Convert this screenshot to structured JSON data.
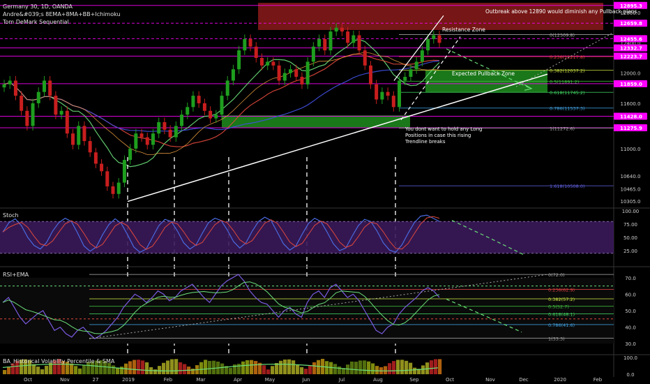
{
  "header": {
    "title": "Germany 30, 1D, OANDA",
    "indicator1": "Andre&#039;s 8EMA+8MA+BB+Ichimoku",
    "indicator2": "Tom DeMark Sequential"
  },
  "annotations": {
    "outbreak": "Outbreak above 12890 would diminish any Pullback plans",
    "resistance_zone": "Resistance Zone",
    "pullback_zone": "Expected Pullback Zone",
    "trendline_note_1": "You dont want to hold any Long",
    "trendline_note_2": "Positions in case this rising",
    "trendline_note_3": "Trendline breaks"
  },
  "panes": {
    "stoch": "Stoch",
    "rsi": "RSI+EMA",
    "hv": "BA_Historical Volatility Percentile & SMA"
  },
  "colors": {
    "background": "#000000",
    "magenta": "#ff00ff",
    "resistance_fill": "#8b1a1a",
    "support_fill": "#1e8c1e",
    "candle_up": "#1e9e1e",
    "candle_down": "#c81e1e",
    "stoch_bg": "#3a1a5a",
    "ema_green": "#6be07a",
    "ma_red": "#e0483c",
    "ma_blue": "#4050e0",
    "trendline": "#ffffff"
  },
  "chart_data": {
    "type": "candlestick",
    "instrument": "Germany 30",
    "timeframe": "1D",
    "x_tick_labels": [
      "Oct",
      "Nov",
      "27",
      "2019",
      "Feb",
      "Mar",
      "Apr",
      "May",
      "Jun",
      "Jul",
      "Aug",
      "Sep",
      "Oct",
      "Nov",
      "Dec",
      "2020",
      "Feb"
    ],
    "y_tick_labels": [
      "12800.0",
      "12400.0",
      "12000.0",
      "11600.0",
      "11000.0",
      "10640.0",
      "10465.0",
      "10305.0"
    ],
    "ylim": [
      10250,
      12930
    ],
    "price_tags": [
      {
        "label": "12895.3",
        "value": 12895.3
      },
      {
        "label": "12659.8",
        "value": 12659.8
      },
      {
        "label": "12455.6",
        "value": 12455.6
      },
      {
        "label": "12332.7",
        "value": 12332.7
      },
      {
        "label": "12223.7",
        "value": 12223.7
      },
      {
        "label": "11859.0",
        "value": 11859.0
      },
      {
        "label": "11428.0",
        "value": 11428.0
      },
      {
        "label": "11275.9",
        "value": 11275.9
      }
    ],
    "fib_levels": [
      {
        "label": "0(12509.8)",
        "value": 12509.8,
        "color": "#aaaaaa"
      },
      {
        "label": "0.236(12217.8)",
        "value": 12217.8,
        "color": "#e04040"
      },
      {
        "label": "0.382(12037.2)",
        "value": 12037.2,
        "color": "#c8e040"
      },
      {
        "label": "0.5(11891.2)",
        "value": 11891.2,
        "color": "#40c040"
      },
      {
        "label": "0.618(11745.2)",
        "value": 11745.2,
        "color": "#40d060"
      },
      {
        "label": "0.786(11537.3)",
        "value": 11537.3,
        "color": "#40a0e0"
      },
      {
        "label": "1(11272.6)",
        "value": 11272.6,
        "color": "#aaaaaa"
      },
      {
        "label": "1.618(10508.0)",
        "value": 10508.0,
        "color": "#6060e0"
      }
    ],
    "zones": [
      {
        "name": "resistance",
        "from": 12570,
        "to": 12930
      },
      {
        "name": "support",
        "from": 11280,
        "to": 11440
      },
      {
        "name": "pullback",
        "from": 11745,
        "to": 12037
      }
    ],
    "close_series": [
      11850,
      11900,
      11700,
      11500,
      11300,
      11600,
      11750,
      11900,
      11700,
      11450,
      11500,
      11200,
      11050,
      11300,
      11100,
      10950,
      10800,
      10700,
      10500,
      10400,
      10550,
      10850,
      11000,
      11200,
      11150,
      11050,
      11200,
      11350,
      11250,
      11150,
      11300,
      11450,
      11550,
      11700,
      11600,
      11500,
      11400,
      11450,
      11700,
      11900,
      12050,
      12300,
      12450,
      12350,
      12200,
      12100,
      12150,
      12100,
      11900,
      12000,
      12050,
      11950,
      11850,
      12150,
      12350,
      12450,
      12300,
      12550,
      12600,
      12550,
      12400,
      12500,
      12300,
      12100,
      11850,
      11650,
      11750,
      11700,
      11550,
      11900,
      11950,
      12050,
      12150,
      12300,
      12450,
      12500,
      12400
    ],
    "stoch": {
      "yticks": [
        "100.00",
        "75.00",
        "50.00",
        "25.00"
      ],
      "ylim": [
        0,
        100
      ],
      "k": [
        60,
        78,
        85,
        72,
        50,
        35,
        28,
        40,
        62,
        78,
        86,
        80,
        58,
        34,
        24,
        32,
        55,
        74,
        85,
        76,
        55,
        32,
        22,
        28,
        50,
        72,
        84,
        80,
        62,
        40,
        28,
        36,
        58,
        78,
        86,
        82,
        64,
        42,
        30,
        40,
        62,
        80,
        88,
        82,
        60,
        38,
        26,
        34,
        56,
        76,
        86,
        80,
        60,
        38,
        25,
        30,
        52,
        72,
        84,
        80,
        62,
        40,
        26,
        22,
        36,
        58,
        78,
        90,
        92,
        86,
        80
      ]
    },
    "rsi": {
      "yticks": [
        "70.0",
        "60.0",
        "50.0",
        "40.0",
        "30.0"
      ],
      "ylim": [
        25,
        75
      ],
      "levels": [
        {
          "label": "0(72.0)",
          "value": 72.0,
          "color": "#aaaaaa"
        },
        {
          "label": "0.236(62.9)",
          "value": 62.9,
          "color": "#e04040"
        },
        {
          "label": "0.382(57.2)",
          "value": 57.2,
          "color": "#c8e040"
        },
        {
          "label": "0.5(52.7)",
          "value": 52.7,
          "color": "#40c040"
        },
        {
          "label": "0.618(48.1)",
          "value": 48.1,
          "color": "#40d060"
        },
        {
          "label": "0.786(41.6)",
          "value": 41.6,
          "color": "#40a0e0"
        },
        {
          "label": "1(33.3)",
          "value": 33.3,
          "color": "#aaaaaa"
        }
      ],
      "values": [
        55,
        58,
        52,
        46,
        42,
        45,
        48,
        50,
        44,
        38,
        40,
        36,
        34,
        38,
        40,
        36,
        33,
        35,
        38,
        42,
        46,
        52,
        56,
        60,
        58,
        55,
        58,
        62,
        60,
        56,
        58,
        62,
        64,
        66,
        62,
        58,
        55,
        60,
        65,
        68,
        70,
        72,
        68,
        62,
        58,
        55,
        54,
        50,
        46,
        50,
        52,
        48,
        46,
        55,
        60,
        62,
        58,
        64,
        66,
        62,
        58,
        60,
        56,
        50,
        44,
        38,
        36,
        40,
        42,
        48,
        52,
        55,
        58,
        62,
        64,
        62,
        58
      ]
    },
    "hv": {
      "yticks": [
        "100.0",
        "0.0"
      ],
      "ylim": [
        0,
        100
      ]
    }
  }
}
